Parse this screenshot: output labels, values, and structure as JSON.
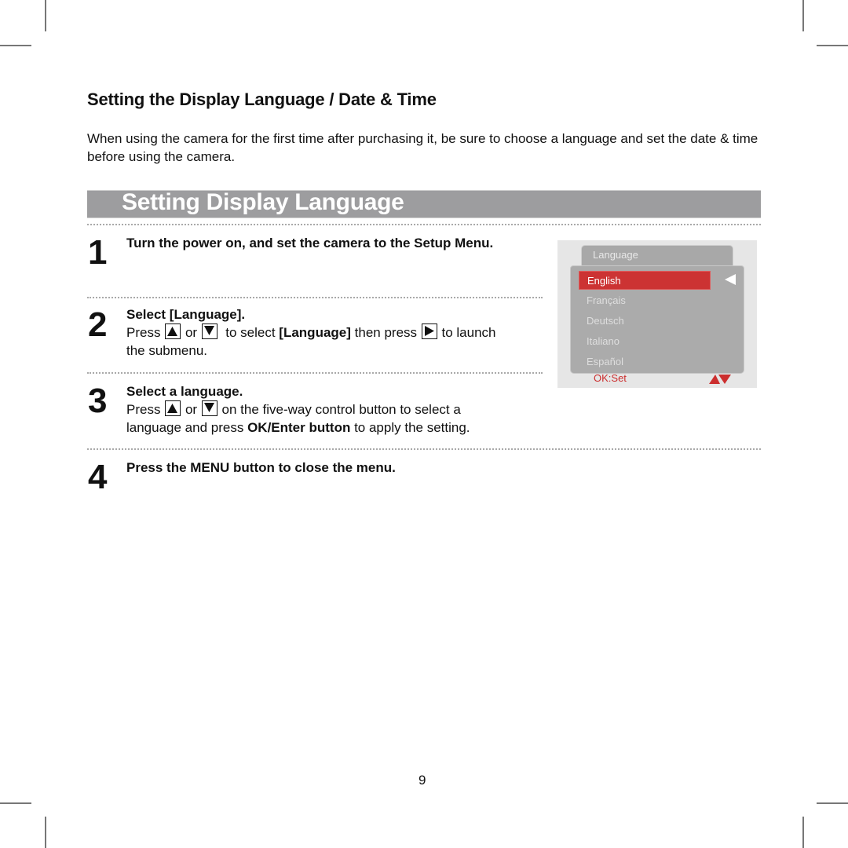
{
  "section_title": "Setting the Display Language / Date & Time",
  "intro": "When using the camera for the first time after purchasing it, be sure to choose a language and set the date & time before using the camera.",
  "banner_title": "Setting Display Language",
  "steps": [
    {
      "number": "1",
      "heading": "Turn the power on, and set the camera to the Setup Menu."
    },
    {
      "number": "2",
      "heading": "Select [Language].",
      "press": "Press",
      "or": "or",
      "to_select": "to select",
      "target": "[Language]",
      "then_press": "then press",
      "to_launch": "to launch",
      "line2": "the submenu."
    },
    {
      "number": "3",
      "heading": "Select a language.",
      "press": "Press",
      "or": "or",
      "rest": "on the five-way control button to select a",
      "line2_pre": "language and press",
      "line2_bold": "OK/Enter button",
      "line2_post": "to apply the setting."
    },
    {
      "number": "4",
      "heading": "Press the MENU button to close the menu."
    }
  ],
  "camera_screen": {
    "tab_label": "Language",
    "languages": [
      "English",
      "Français",
      "Deutsch",
      "Italiano",
      "Español"
    ],
    "selected_index": 0,
    "footer_hint": "OK:Set",
    "accent_color": "#cc3333",
    "icons": [
      "arrow-left-icon",
      "up-down-arrows-icon"
    ]
  },
  "key_icons": [
    "up-arrow-key-icon",
    "down-arrow-key-icon",
    "right-arrow-key-icon"
  ],
  "page_number": "9"
}
